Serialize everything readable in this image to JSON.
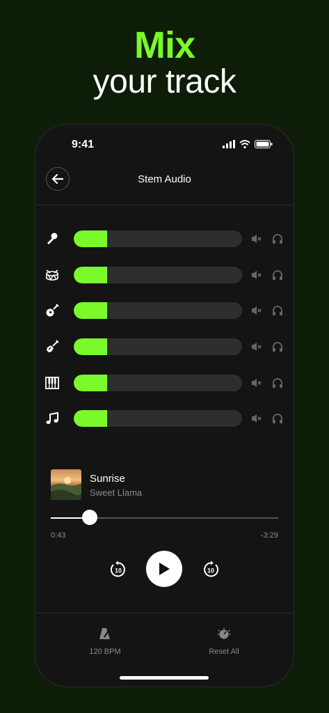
{
  "promo": {
    "headline_line1": "Mix",
    "headline_line2": "your track"
  },
  "status_bar": {
    "time": "9:41"
  },
  "nav": {
    "title": "Stem Audio"
  },
  "stems": [
    {
      "instrument": "vocals",
      "icon": "microphone-icon",
      "level": 0.2
    },
    {
      "instrument": "drums",
      "icon": "drum-icon",
      "level": 0.2
    },
    {
      "instrument": "acoustic-guitar",
      "icon": "acoustic-guitar-icon",
      "level": 0.2
    },
    {
      "instrument": "electric-guitar",
      "icon": "electric-guitar-icon",
      "level": 0.2
    },
    {
      "instrument": "piano",
      "icon": "piano-icon",
      "level": 0.2
    },
    {
      "instrument": "other",
      "icon": "music-note-icon",
      "level": 0.2
    }
  ],
  "player": {
    "title": "Sunrise",
    "artist": "Sweet Llama",
    "elapsed": "0:43",
    "remaining": "-3:29",
    "progress": 0.17,
    "skip_seconds": "10"
  },
  "bottom_bar": {
    "bpm_label": "120 BPM",
    "reset_label": "Reset All"
  },
  "colors": {
    "accent": "#7af92b",
    "background": "#0e1d08",
    "phone": "#141414"
  }
}
